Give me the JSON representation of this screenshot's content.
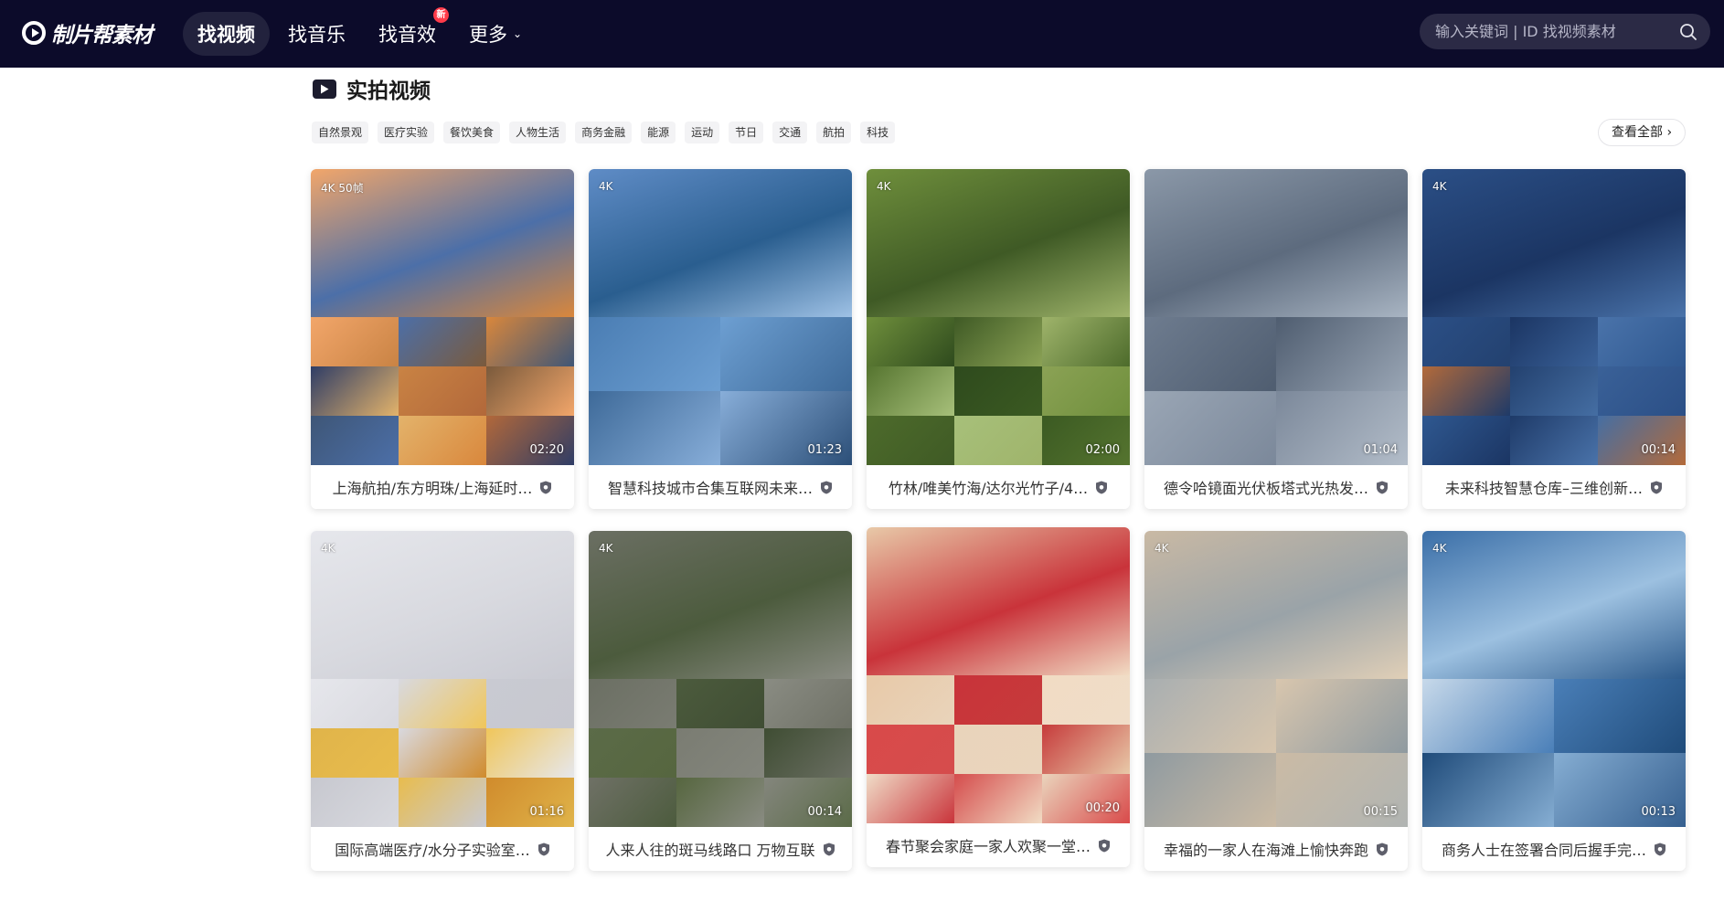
{
  "header": {
    "logo_text": "制片帮素材",
    "nav": [
      {
        "label": "找视频",
        "active": true
      },
      {
        "label": "找音乐",
        "active": false
      },
      {
        "label": "找音效",
        "active": false,
        "badge": "新"
      },
      {
        "label": "更多",
        "active": false,
        "has_dropdown": true
      }
    ],
    "search": {
      "placeholder": "输入关键词 | ID 找视频素材"
    }
  },
  "section": {
    "title": "实拍视频",
    "tags": [
      "自然景观",
      "医疗实验",
      "餐饮美食",
      "人物生活",
      "商务金融",
      "能源",
      "运动",
      "节日",
      "交通",
      "航拍",
      "科技"
    ],
    "view_all": "查看全部 ›"
  },
  "cards": [
    {
      "title": "上海航拍/东方明珠/上海延时…",
      "quality": "4K  50帧",
      "duration": "02:20",
      "palette": [
        "#f2a66a",
        "#4c6fa8",
        "#d9873c",
        "#2f3d66",
        "#c98344",
        "#7a5a3c",
        "#3e5677",
        "#e3b36b",
        "#b2683a"
      ]
    },
    {
      "title": "智慧科技城市合集互联网未来…",
      "quality": "4K",
      "duration": "01:23",
      "palette": [
        "#5f8cc6",
        "#2a5e8f",
        "#9ec1e5",
        "#4a7db3",
        "#6d9fd2",
        "#3e6a99",
        "#88aed9",
        "#2c4f78",
        "#a8c7e6"
      ]
    },
    {
      "title": "竹林/唯美竹海/达尔光竹子/4…",
      "quality": "4K",
      "duration": "02:00",
      "palette": [
        "#6f8f3c",
        "#3f5a25",
        "#9fb46b",
        "#55742f",
        "#2e4a1d",
        "#8ba255",
        "#4d6b2b",
        "#a7c07a",
        "#3b5a22"
      ]
    },
    {
      "title": "德令哈镜面光伏板塔式光热发…",
      "quality": "",
      "duration": "01:04",
      "palette": [
        "#8b98a8",
        "#5d6b7e",
        "#a8b4c2",
        "#6e7c8f",
        "#4f5d70",
        "#9aa6b5",
        "#7b889a",
        "#b3bdc9",
        "#5a6778"
      ]
    },
    {
      "title": "未来科技智慧仓库–三维创新…",
      "quality": "4K",
      "duration": "00:14",
      "palette": [
        "#2b4f86",
        "#1b3563",
        "#4a73aa",
        "#b36a3a",
        "#23416f",
        "#3a6198",
        "#2f5890",
        "#1e3a68",
        "#456ea3"
      ]
    },
    {
      "title": "国际高端医疗/水分子实验室…",
      "quality": "4K",
      "duration": "01:16",
      "palette": [
        "#e6e7ec",
        "#d8d9df",
        "#c9cad2",
        "#e0b44a",
        "#d9d9df",
        "#f0c65a",
        "#c7c8cf",
        "#e8bc4d",
        "#d08b2c"
      ]
    },
    {
      "title": "人来人往的斑马线路口 万物互联",
      "quality": "4K",
      "duration": "00:14",
      "palette": [
        "#6b6f63",
        "#4c5b3d",
        "#8a8c83",
        "#5b6b48",
        "#7a7c72",
        "#3f4d33",
        "#6f7166",
        "#56663f",
        "#84867d"
      ]
    },
    {
      "title": "春节聚会家庭一家人欢聚一堂…",
      "quality": "",
      "duration": "00:20",
      "palette": [
        "#e8c9a8",
        "#c9333a",
        "#f1dcc4",
        "#d94a4a",
        "#e9d4bb",
        "#c63b3b",
        "#f0ddc8",
        "#d54c4c",
        "#ead5bd"
      ]
    },
    {
      "title": "幸福的一家人在海滩上愉快奔跑",
      "quality": "4K",
      "duration": "00:15",
      "palette": [
        "#c9b9a4",
        "#9aa3a8",
        "#e0cfb7",
        "#a8aeb0",
        "#d8c6ae",
        "#8f9aa0",
        "#cbbba5",
        "#b0b4b2",
        "#e3d2ba"
      ]
    },
    {
      "title": "商务人士在签署合同后握手完…",
      "quality": "4K",
      "duration": "00:13",
      "palette": [
        "#3b6fa8",
        "#9cc0e0",
        "#2c5a8c",
        "#c7d9ea",
        "#4a7fb8",
        "#1f4b7a",
        "#86aed3",
        "#355f8f",
        "#b6cde3"
      ]
    }
  ]
}
